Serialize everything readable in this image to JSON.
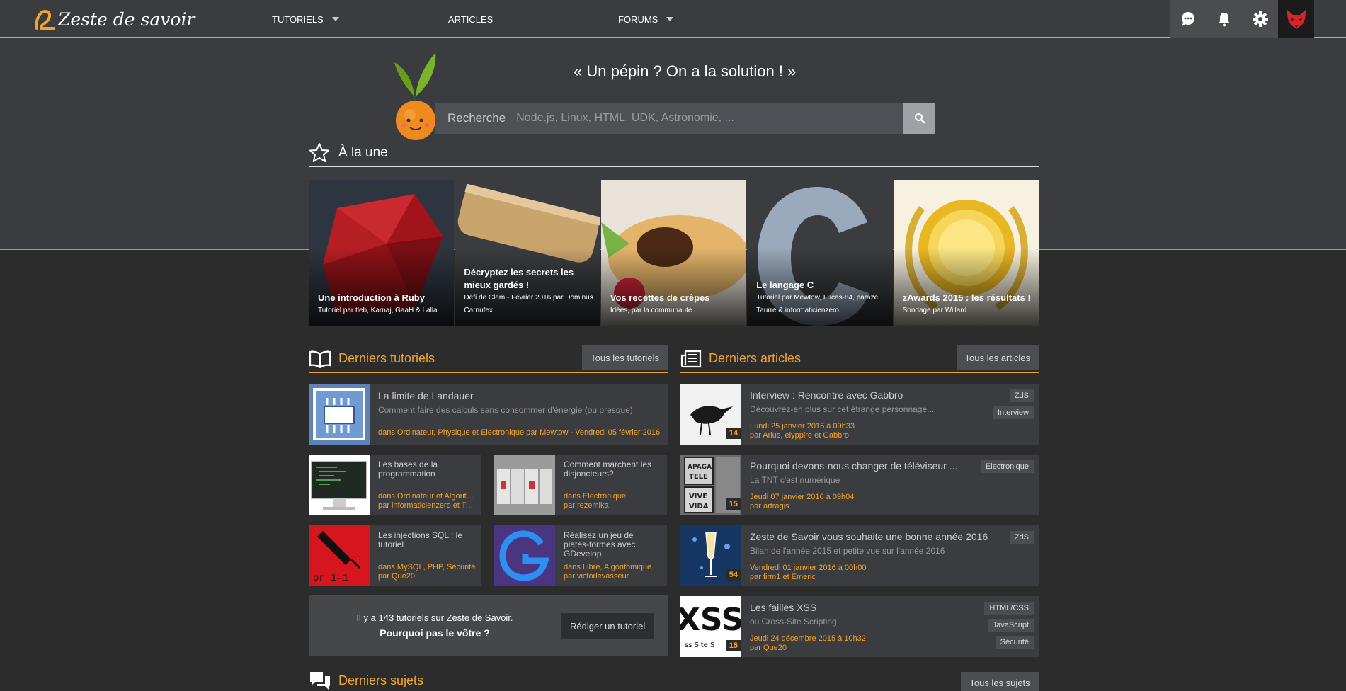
{
  "header": {
    "logo_text": "Zeste de savoir",
    "nav": [
      {
        "label": "TUTORIELS",
        "dropdown": true
      },
      {
        "label": "ARTICLES",
        "dropdown": false
      },
      {
        "label": "FORUMS",
        "dropdown": true
      }
    ],
    "icons": [
      "chat-icon",
      "bell-icon",
      "gear-icon",
      "fox-avatar"
    ],
    "accent_color": "#f2a32c"
  },
  "hero": {
    "slogan": "« Un pépin ? On a la solution ! »",
    "search_label": "Recherche",
    "search_placeholder": "Node.js, Linux, HTML, UDK, Astronomie, ..."
  },
  "une": {
    "title": "À la une",
    "cards": [
      {
        "title": "Une introduction à Ruby",
        "subtitle": "Tutoriel par tleb, Karnaj, GaaH & Lalla"
      },
      {
        "title": "Décryptez les secrets les mieux gardés !",
        "subtitle": "Défi de Clem - Février 2016 par Dominus Carnufex"
      },
      {
        "title": "Vos recettes de crêpes",
        "subtitle": "Idées, par la communauté"
      },
      {
        "title": "Le langage C",
        "subtitle": "Tutoriel par Mewtow, Lucas-84, paraze, Taurre & informaticienzero"
      },
      {
        "title": "zAwards 2015 : les résultats !",
        "subtitle": "Sondage par Willard"
      }
    ]
  },
  "tutorials": {
    "title": "Derniers tutoriels",
    "all_button": "Tous les tutoriels",
    "featured": {
      "title": "La limite de Landauer",
      "subtitle": "Comment faire des calculs sans consommer d'énergie (ou presque)",
      "meta": "dans Ordinateur, Physique et Electronique par Mewtow - Vendredi 05 février 2016"
    },
    "items": [
      {
        "title": "Les bases de la programmation",
        "cat": "dans Ordinateur et Algorithmique",
        "author": "par informaticienzero et Taurre"
      },
      {
        "title": "Comment marchent les disjoncteurs?",
        "cat": "dans Electronique",
        "author": "par rezemika"
      },
      {
        "title": "Les injections SQL : le tutoriel",
        "cat": "dans MySQL, PHP, Sécurité",
        "author": "par Que20"
      },
      {
        "title": "Réalisez un jeu de plates-formes avec GDevelop",
        "cat": "dans Libre, Algorithmique",
        "author": "par victorlevasseur"
      }
    ],
    "promo_line1": "Il y a 143 tutoriels sur Zeste de Savoir.",
    "promo_line2": "Pourquoi pas le vôtre ?",
    "promo_button": "Rédiger un tutoriel"
  },
  "articles": {
    "title": "Derniers articles",
    "all_button": "Tous les articles",
    "items": [
      {
        "title": "Interview : Rencontre avec Gabbro",
        "subtitle": "Découvrez-en plus sur cet étrange personnage...",
        "date": "Lundi 25 janvier 2016 à 09h33",
        "authors": "par Arius, elyppire et Gabbro",
        "count": "14",
        "tags": [
          "ZdS",
          "Interview"
        ]
      },
      {
        "title": "Pourquoi devons-nous changer de téléviseur ...",
        "subtitle": "La TNT c'est numérique",
        "date": "Jeudi 07 janvier 2016 à 09h04",
        "authors": "par artragis",
        "count": "15",
        "tags": [
          "Electronique"
        ]
      },
      {
        "title": "Zeste de Savoir vous souhaite une bonne année 2016",
        "subtitle": "Bilan de l'année 2015 et petite vue sur l'année 2016",
        "date": "Vendredi 01 janvier 2016 à 00h00",
        "authors": "par firm1 et Emeric",
        "count": "54",
        "tags": [
          "ZdS"
        ]
      },
      {
        "title": "Les failles XSS",
        "subtitle": "ou Cross-Site Scripting",
        "date": "Jeudi 24 décembre 2015 à 10h32",
        "authors": "par Que20",
        "count": "15",
        "tags": [
          "HTML/CSS",
          "JavaScript",
          "Sécurité"
        ]
      }
    ]
  },
  "sujets": {
    "title": "Derniers sujets",
    "all_button": "Tous les sujets"
  }
}
